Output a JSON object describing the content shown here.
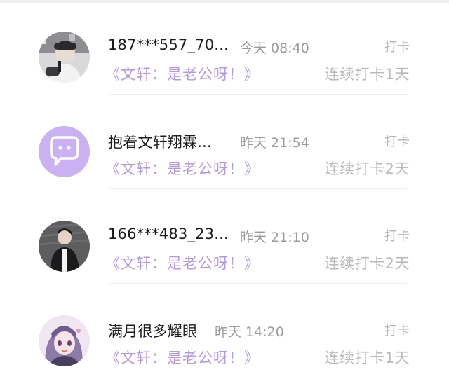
{
  "checkins": [
    {
      "username": "187***557_70...",
      "time": "今天 08:40",
      "action": "打卡",
      "topic": "《文轩：是老公呀！》",
      "streak": "连续打卡1天",
      "avatar_icon": "user-photo-icon"
    },
    {
      "username": "抱着文轩翔霖...",
      "time": "昨天 21:54",
      "action": "打卡",
      "topic": "《文轩：是老公呀！》",
      "streak": "连续打卡2天",
      "avatar_icon": "chat-bubble-icon"
    },
    {
      "username": "166***483_23...",
      "time": "昨天 21:10",
      "action": "打卡",
      "topic": "《文轩：是老公呀！》",
      "streak": "连续打卡2天",
      "avatar_icon": "user-photo-icon"
    },
    {
      "username": "满月很多耀眼",
      "time": "昨天 14:20",
      "action": "打卡",
      "topic": "《文轩：是老公呀！》",
      "streak": "连续打卡1天",
      "avatar_icon": "anime-girl-icon"
    }
  ],
  "colors": {
    "topic_purple": "#b49ad8",
    "chat_avatar_bg": "#c9b2ef"
  }
}
